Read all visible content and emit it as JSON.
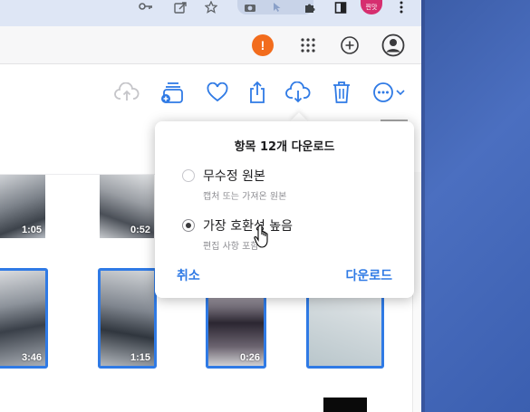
{
  "browser": {
    "profile_badge": "찐맛",
    "warning_badge": "!"
  },
  "photos": {
    "thumbnails": [
      {
        "duration": "1:05",
        "selected": false
      },
      {
        "duration": "0:52",
        "selected": false
      },
      {
        "duration": "3:46",
        "selected": true
      },
      {
        "duration": "1:15",
        "selected": true
      },
      {
        "duration": "0:26",
        "selected": true
      },
      {
        "duration": "",
        "selected": true
      }
    ]
  },
  "download_popover": {
    "title": "항목 12개 다운로드",
    "options": [
      {
        "label": "무수정 원본",
        "sub": "캡처 또는 가져온 원본",
        "selected": false
      },
      {
        "label": "가장 호환성 높음",
        "sub": "편집 사항 포함",
        "selected": true
      }
    ],
    "cancel_label": "취소",
    "download_label": "다운로드"
  },
  "colors": {
    "accent": "#2f7ae5",
    "warning": "#f26c1d",
    "desktop": "#4b6fc0"
  }
}
